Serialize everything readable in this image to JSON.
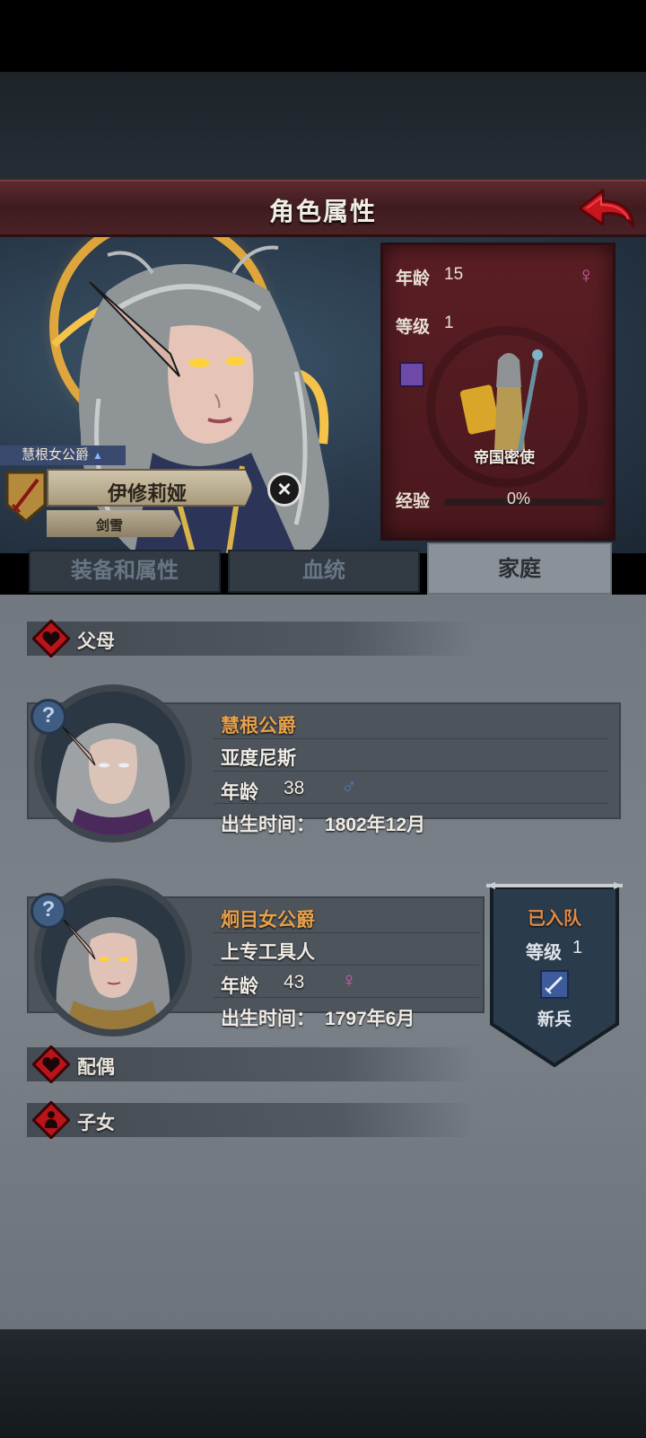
{
  "header": {
    "title": "角色属性"
  },
  "hero": {
    "title_tag": "慧根女公爵",
    "name": "伊修莉娅",
    "class": "剑雪",
    "stats": {
      "age_label": "年龄",
      "age": "15",
      "level_label": "等级",
      "level": "1",
      "unit_name": "帝国密使",
      "exp_label": "经验",
      "exp_percent": "0%",
      "exp_fraction": 0.0,
      "gender": "female"
    }
  },
  "tabs": [
    {
      "label": "装备和属性",
      "active": false
    },
    {
      "label": "血统",
      "active": false
    },
    {
      "label": "家庭",
      "active": true
    }
  ],
  "family": {
    "parents_label": "父母",
    "spouse_label": "配偶",
    "children_label": "子女",
    "members": [
      {
        "title": "慧根公爵",
        "name": "亚度尼斯",
        "age_label": "年龄",
        "age": "38",
        "gender": "male",
        "gender_symbol": "♂",
        "birth_label": "出生时间：",
        "birth": "1802年12月"
      },
      {
        "title": "炯目女公爵",
        "name": "上专工具人",
        "age_label": "年龄",
        "age": "43",
        "gender": "female",
        "gender_symbol": "♀",
        "birth_label": "出生时间：",
        "birth": "1797年6月"
      }
    ],
    "banner": {
      "status": "已入队",
      "level_label": "等级",
      "level": "1",
      "class": "新兵"
    }
  },
  "colors": {
    "accent_orange": "#e6a04a",
    "male_blue": "#4a78c8",
    "female_pink": "#d05ca8",
    "title_red": "#4f2226"
  }
}
